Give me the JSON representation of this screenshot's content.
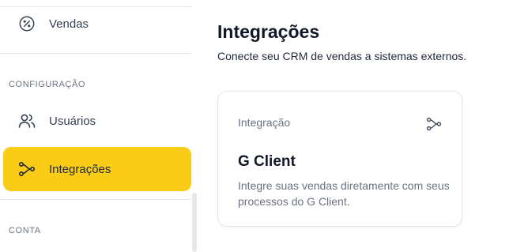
{
  "sidebar": {
    "items": [
      {
        "label": "Vendas",
        "icon": "percent-circle-icon"
      },
      {
        "label": "Usuários",
        "icon": "users-icon"
      },
      {
        "label": "Integrações",
        "icon": "integrations-icon",
        "active": true
      }
    ],
    "sections": {
      "configuracao": "CONFIGURAÇÃO",
      "conta": "CONTA"
    }
  },
  "main": {
    "title": "Integrações",
    "subtitle": "Conecte seu CRM de vendas a sistemas externos.",
    "cards": [
      {
        "tag": "Integração",
        "icon": "integrations-icon",
        "title": "G Client",
        "description": "Integre suas vendas diretamente com seus processos do G Client."
      }
    ]
  },
  "colors": {
    "accent": "#facc15",
    "border": "#e5e7eb",
    "muted_text": "#6b7280"
  }
}
